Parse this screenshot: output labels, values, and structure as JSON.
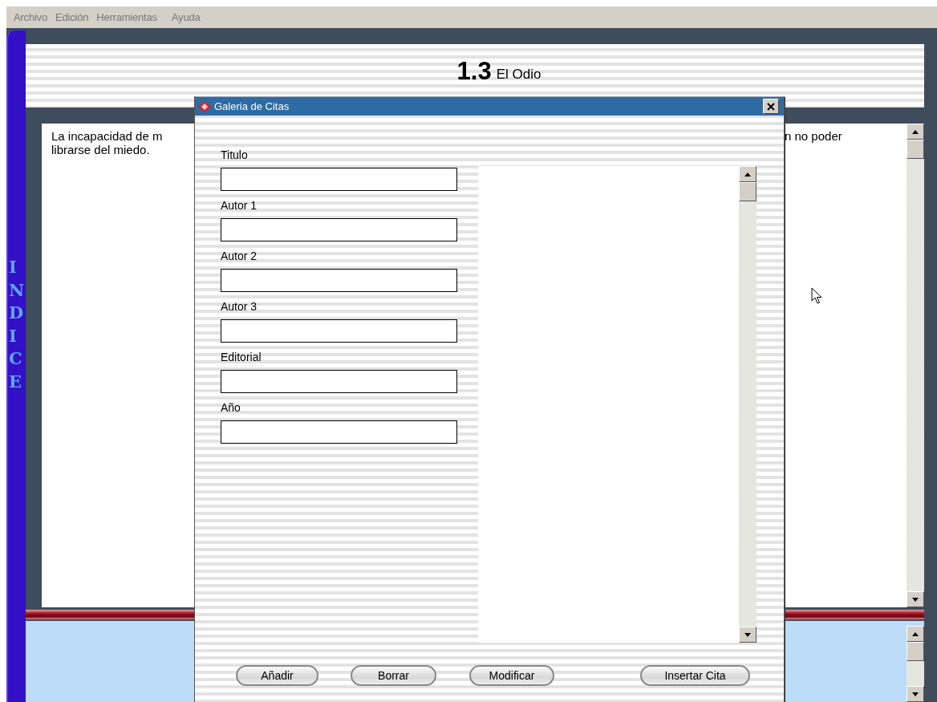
{
  "menu": [
    "Archivo",
    "Edición",
    "Herramientas",
    "Ayuda"
  ],
  "sidebar": {
    "label": "INDICE"
  },
  "page": {
    "number": "1.3",
    "title": "El Odio"
  },
  "content": {
    "text_left": [
      "La incapacidad de m",
      "librarse del miedo."
    ],
    "text_right": [
      "n no poder"
    ]
  },
  "dialog": {
    "title": "Galeria de Citas",
    "fields": [
      {
        "label": "Titulo"
      },
      {
        "label": "Autor 1"
      },
      {
        "label": "Autor 2"
      },
      {
        "label": "Autor 3"
      },
      {
        "label": "Editorial"
      },
      {
        "label": "Año"
      }
    ],
    "buttons": [
      "Añadir",
      "Borrar",
      "Modificar",
      "Insertar Cita"
    ]
  }
}
